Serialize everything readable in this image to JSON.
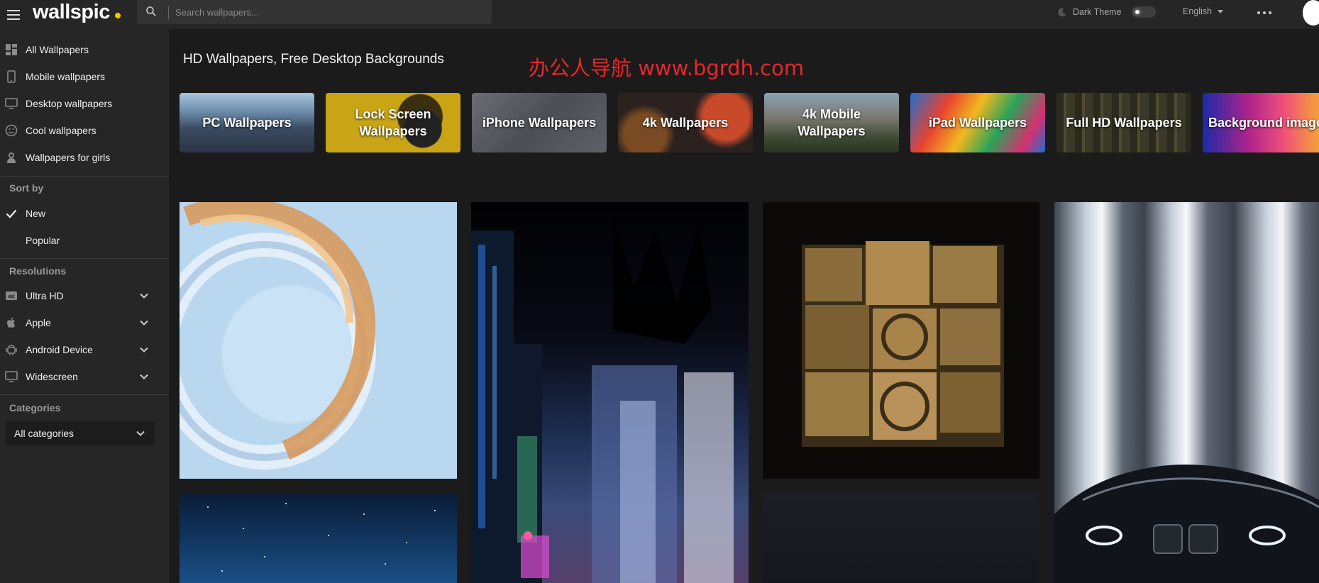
{
  "header": {
    "logo": "wallspic",
    "search_placeholder": "Search wallpapers...",
    "dark_theme_label": "Dark Theme",
    "language": "English"
  },
  "sidebar": {
    "nav": [
      {
        "label": "All Wallpapers",
        "icon": "grid-icon"
      },
      {
        "label": "Mobile wallpapers",
        "icon": "phone-icon"
      },
      {
        "label": "Desktop wallpapers",
        "icon": "monitor-icon"
      },
      {
        "label": "Cool wallpapers",
        "icon": "smiley-icon"
      },
      {
        "label": "Wallpapers for girls",
        "icon": "girl-icon"
      }
    ],
    "sort_heading": "Sort by",
    "sort": [
      {
        "label": "New",
        "selected": true
      },
      {
        "label": "Popular",
        "selected": false
      }
    ],
    "resolutions_heading": "Resolutions",
    "resolutions": [
      {
        "label": "Ultra HD",
        "icon": "4k-icon"
      },
      {
        "label": "Apple",
        "icon": "apple-icon"
      },
      {
        "label": "Android Device",
        "icon": "android-icon"
      },
      {
        "label": "Widescreen",
        "icon": "monitor-icon"
      }
    ],
    "categories_heading": "Categories",
    "categories_value": "All categories"
  },
  "main": {
    "title": "HD Wallpapers, Free Desktop Backgrounds",
    "watermark": "办公人导航 www.bgrdh.com",
    "categories": [
      {
        "label": "PC Wallpapers"
      },
      {
        "label": "Lock Screen Wallpapers"
      },
      {
        "label": "iPhone Wallpapers"
      },
      {
        "label": "4k Wallpapers"
      },
      {
        "label": "4k Mobile Wallpapers"
      },
      {
        "label": "iPad Wallpapers"
      },
      {
        "label": "Full HD Wallpapers"
      },
      {
        "label": "Background image"
      }
    ]
  },
  "colors": {
    "background": "#1b1b1b",
    "panel": "#262626",
    "logo_dot": "#f7c600",
    "watermark": "#e4282b"
  }
}
